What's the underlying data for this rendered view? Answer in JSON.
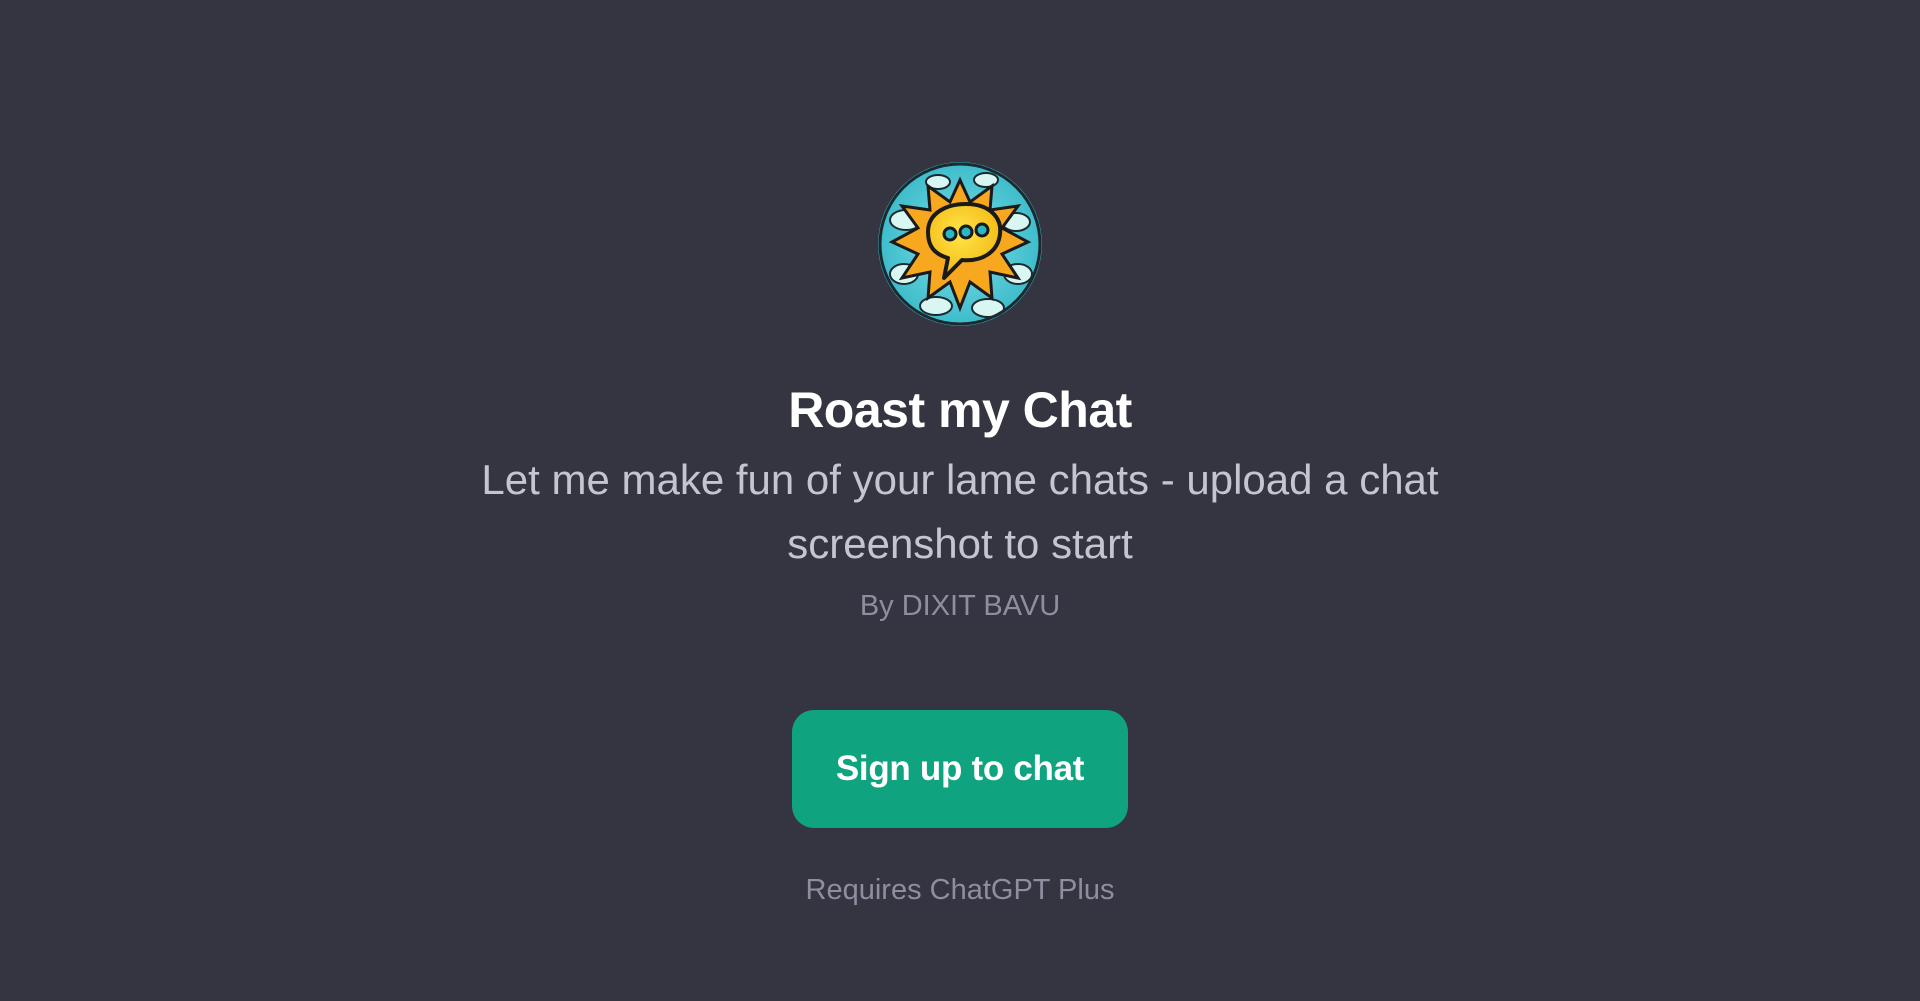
{
  "gpt": {
    "name": "Roast my Chat",
    "description": "Let me make fun of your lame chats - upload a chat screenshot to start",
    "author": "By DIXIT BAVU",
    "avatar_icon": "comic-speech-bubble-icon"
  },
  "actions": {
    "signup_label": "Sign up to chat",
    "requirement": "Requires ChatGPT Plus"
  },
  "colors": {
    "background": "#343541",
    "accent": "#10a37f",
    "title": "#ffffff",
    "description": "#c5c5d2",
    "muted": "#8e8ea0"
  }
}
